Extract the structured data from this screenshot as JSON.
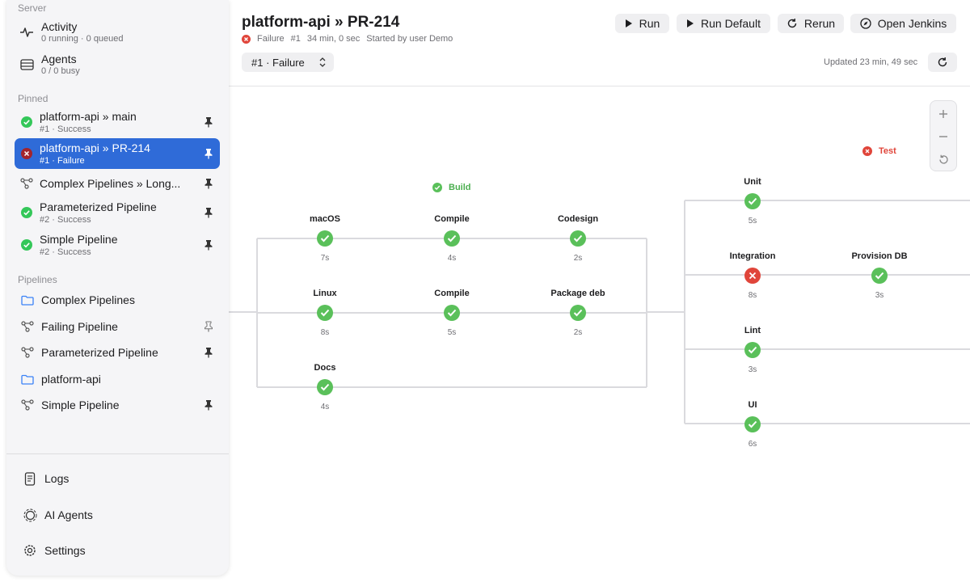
{
  "sidebar": {
    "server_title": "Server",
    "activity": {
      "label": "Activity",
      "sub": "0 running · 0 queued",
      "icon": "activity-pulse-icon"
    },
    "agents": {
      "label": "Agents",
      "sub": "0 / 0 busy",
      "icon": "server-rack-icon"
    },
    "pinned_title": "Pinned",
    "pinned": [
      {
        "label": "platform-api » main",
        "sub": "#1 · Success",
        "status": "success"
      },
      {
        "label": "platform-api » PR-214",
        "sub": "#1 · Failure",
        "status": "failure"
      },
      {
        "label": "Complex Pipelines » Long...",
        "sub": "",
        "status": "pipeline"
      },
      {
        "label": "Parameterized Pipeline",
        "sub": "#2 · Success",
        "status": "success"
      },
      {
        "label": "Simple Pipeline",
        "sub": "#2 · Success",
        "status": "success"
      }
    ],
    "pipelines_title": "Pipelines",
    "pipelines": [
      {
        "label": "Complex Pipelines",
        "type": "folder"
      },
      {
        "label": "Failing Pipeline",
        "type": "pipeline"
      },
      {
        "label": "Parameterized Pipeline",
        "type": "pipeline"
      },
      {
        "label": "platform-api",
        "type": "folder"
      },
      {
        "label": "Simple Pipeline",
        "type": "pipeline"
      }
    ],
    "bottom": [
      {
        "label": "Logs",
        "icon": "document-icon"
      },
      {
        "label": "AI Agents",
        "icon": "ai-sparkle-icon"
      },
      {
        "label": "Settings",
        "icon": "gear-icon"
      }
    ]
  },
  "header": {
    "title": "platform-api » PR-214",
    "status": "Failure",
    "run_number": "#1",
    "duration": "34 min, 0 sec",
    "started_by": "Started by user Demo",
    "run_select": "#1 · Failure",
    "updated": "Updated 23 min, 49 sec",
    "buttons": {
      "run": "Run",
      "run_default": "Run Default",
      "rerun": "Rerun",
      "open_jenkins": "Open Jenkins"
    }
  },
  "graph": {
    "stages": {
      "build": "Build",
      "test": "Test"
    },
    "build_nodes": [
      {
        "name": "macOS",
        "status": "success",
        "duration": "7s"
      },
      {
        "name": "Compile",
        "status": "success",
        "duration": "4s"
      },
      {
        "name": "Codesign",
        "status": "success",
        "duration": "2s"
      },
      {
        "name": "Linux",
        "status": "success",
        "duration": "8s"
      },
      {
        "name": "Compile",
        "status": "success",
        "duration": "5s"
      },
      {
        "name": "Package deb",
        "status": "success",
        "duration": "2s"
      },
      {
        "name": "Docs",
        "status": "success",
        "duration": "4s"
      }
    ],
    "test_nodes": [
      {
        "name": "Unit",
        "status": "success",
        "duration": "5s"
      },
      {
        "name": "Integration",
        "status": "failure",
        "duration": "8s"
      },
      {
        "name": "Provision DB",
        "status": "success",
        "duration": "3s"
      },
      {
        "name": "Lint",
        "status": "success",
        "duration": "3s"
      },
      {
        "name": "UI",
        "status": "success",
        "duration": "6s"
      }
    ]
  },
  "colors": {
    "success": "#5ac05a",
    "failure": "#e0453a",
    "accent": "#2f6bd8"
  }
}
